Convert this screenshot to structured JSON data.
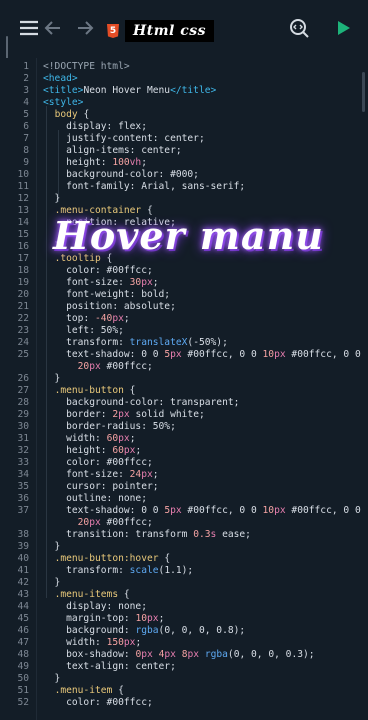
{
  "toolbar": {
    "menu_icon": "hamburger-icon",
    "undo_icon": "arrow-left-icon",
    "redo_icon": "arrow-right-icon",
    "file_type_icon": "html5-icon",
    "tab_title": "Html css",
    "search_icon": "search-code-icon",
    "run_icon": "play-icon",
    "run_color": "#1db37a"
  },
  "overlay": {
    "title": "Hover manu"
  },
  "lines": [
    {
      "n": "1",
      "t": "<!DOCTYPE html>"
    },
    {
      "n": "2",
      "t": "<head>"
    },
    {
      "n": "3",
      "t": "<title>Neon Hover Menu</title>"
    },
    {
      "n": "4",
      "t": "<style>"
    },
    {
      "n": "5",
      "t": "  body {"
    },
    {
      "n": "6",
      "t": "    display: flex;"
    },
    {
      "n": "7",
      "t": "    justify-content: center;"
    },
    {
      "n": "8",
      "t": "    align-items: center;"
    },
    {
      "n": "9",
      "t": "    height: 100vh;"
    },
    {
      "n": "10",
      "t": "    background-color: #000;"
    },
    {
      "n": "11",
      "t": "    font-family: Arial, sans-serif;"
    },
    {
      "n": "12",
      "t": "  }"
    },
    {
      "n": "13",
      "t": "  .menu-container {"
    },
    {
      "n": "14",
      "t": "    position: relative;"
    },
    {
      "n": "15",
      "t": ""
    },
    {
      "n": "16",
      "t": "  }"
    },
    {
      "n": "17",
      "t": "  .tooltip {"
    },
    {
      "n": "18",
      "t": "    color: #00ffcc;"
    },
    {
      "n": "19",
      "t": "    font-size: 30px;"
    },
    {
      "n": "20",
      "t": "    font-weight: bold;"
    },
    {
      "n": "21",
      "t": "    position: absolute;"
    },
    {
      "n": "22",
      "t": "    top: -40px;"
    },
    {
      "n": "23",
      "t": "    left: 50%;"
    },
    {
      "n": "24",
      "t": "    transform: translateX(-50%);"
    },
    {
      "n": "25",
      "t": "    text-shadow: 0 0 5px #00ffcc, 0 0 10px #00ffcc, 0 0"
    },
    {
      "n": "",
      "t": "      20px #00ffcc;"
    },
    {
      "n": "26",
      "t": "  }"
    },
    {
      "n": "27",
      "t": "  .menu-button {"
    },
    {
      "n": "28",
      "t": "    background-color: transparent;"
    },
    {
      "n": "29",
      "t": "    border: 2px solid white;"
    },
    {
      "n": "30",
      "t": "    border-radius: 50%;"
    },
    {
      "n": "31",
      "t": "    width: 60px;"
    },
    {
      "n": "32",
      "t": "    height: 60px;"
    },
    {
      "n": "33",
      "t": "    color: #00ffcc;"
    },
    {
      "n": "34",
      "t": "    font-size: 24px;"
    },
    {
      "n": "35",
      "t": "    cursor: pointer;"
    },
    {
      "n": "36",
      "t": "    outline: none;"
    },
    {
      "n": "37",
      "t": "    text-shadow: 0 0 5px #00ffcc, 0 0 10px #00ffcc, 0 0"
    },
    {
      "n": "",
      "t": "      20px #00ffcc;"
    },
    {
      "n": "38",
      "t": "    transition: transform 0.3s ease;"
    },
    {
      "n": "39",
      "t": "  }"
    },
    {
      "n": "40",
      "t": "  .menu-button:hover {"
    },
    {
      "n": "41",
      "t": "    transform: scale(1.1);"
    },
    {
      "n": "42",
      "t": "  }"
    },
    {
      "n": "43",
      "t": "  .menu-items {"
    },
    {
      "n": "44",
      "t": "    display: none;"
    },
    {
      "n": "45",
      "t": "    margin-top: 10px;"
    },
    {
      "n": "46",
      "t": "    background: rgba(0, 0, 0, 0.8);"
    },
    {
      "n": "47",
      "t": "    width: 150px;"
    },
    {
      "n": "48",
      "t": "    box-shadow: 0px 4px 8px rgba(0, 0, 0, 0.3);"
    },
    {
      "n": "49",
      "t": "    text-align: center;"
    },
    {
      "n": "50",
      "t": "  }"
    },
    {
      "n": "51",
      "t": "  .menu-item {"
    },
    {
      "n": "52",
      "t": "    color: #00ffcc;"
    }
  ]
}
